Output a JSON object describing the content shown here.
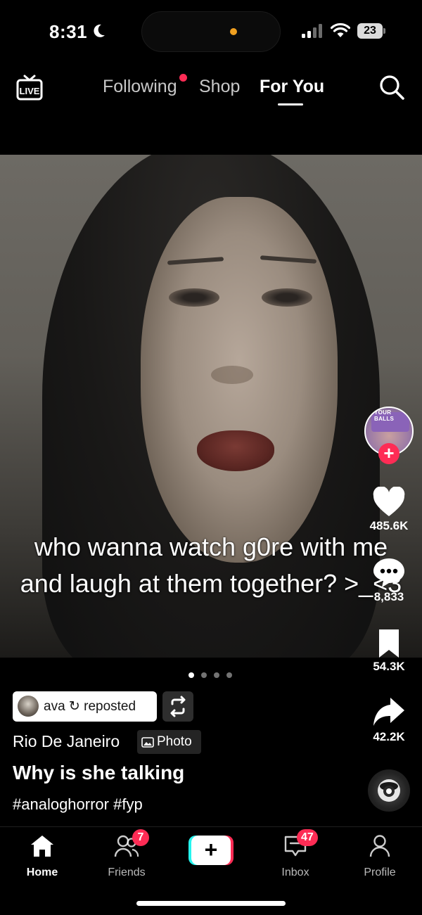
{
  "status_bar": {
    "time": "8:31",
    "battery": "23",
    "icons": [
      "moon-icon",
      "signal-icon",
      "wifi-icon",
      "battery-icon"
    ]
  },
  "top_nav": {
    "live_label": "LIVE",
    "tabs": [
      {
        "label": "Following"
      },
      {
        "label": "Shop"
      },
      {
        "label": "For You"
      }
    ],
    "active_tab": "For You"
  },
  "post": {
    "caption": "who wanna watch g0re with me and laugh at them together? >_<3",
    "likes": "485.6K",
    "comments": "8,833",
    "bookmarks": "54.3K",
    "shares": "42.2K",
    "creator_avatar_text": "YOUR BALLS",
    "carousel_total": 4,
    "carousel_active": 1,
    "repost_text": "ava ↻ reposted",
    "location": "Rio De Janeiro",
    "media_type_label": "Photo",
    "title": "Why is she talking",
    "hashtags": "#analoghorror #fyp"
  },
  "tab_bar": {
    "home": "Home",
    "friends": "Friends",
    "friends_badge": "7",
    "create": "+",
    "inbox": "Inbox",
    "inbox_badge": "47",
    "profile": "Profile"
  },
  "colors": {
    "accent": "#fe2c55",
    "cyan": "#25f4ee",
    "background": "#000000"
  }
}
